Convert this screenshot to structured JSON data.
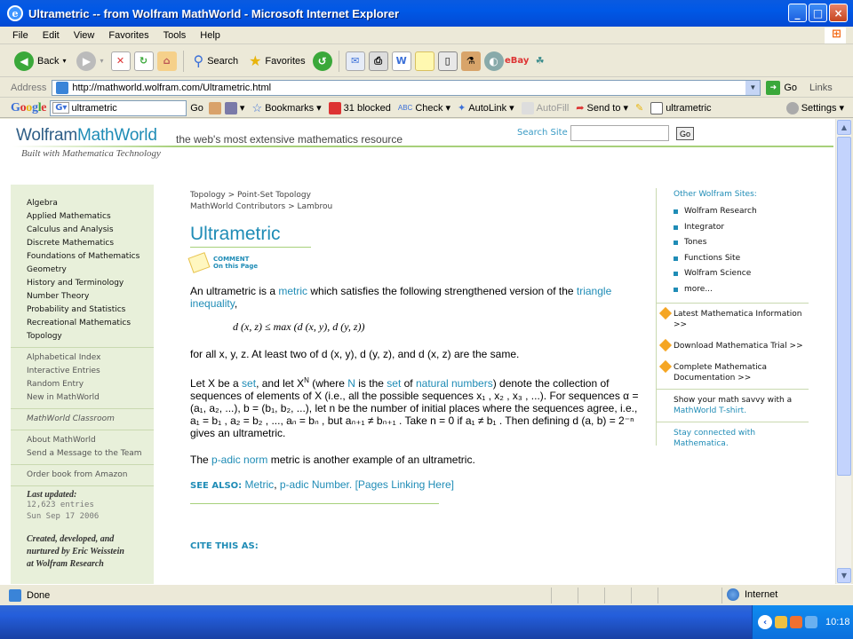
{
  "window": {
    "title": "Ultrametric -- from Wolfram MathWorld - Microsoft Internet Explorer"
  },
  "menu": [
    "File",
    "Edit",
    "View",
    "Favorites",
    "Tools",
    "Help"
  ],
  "toolbar": {
    "back": "Back",
    "search": "Search",
    "favorites": "Favorites"
  },
  "address": {
    "label": "Address",
    "url": "http://mathworld.wolfram.com/Ultrametric.html",
    "go": "Go",
    "links": "Links"
  },
  "google": {
    "logo": "Google",
    "query": "ultrametric",
    "go": "Go",
    "bookmarks": "Bookmarks",
    "blocked": "31 blocked",
    "check": "Check",
    "autolink": "AutoLink",
    "autofill": "AutoFill",
    "sendto": "Send to",
    "highlight": "ultrametric",
    "settings": "Settings"
  },
  "site": {
    "logo_a": "Wolfram",
    "logo_b": "MathWorld",
    "tagline": "the web's most extensive mathematics resource",
    "built": "Built with Mathematica Technology",
    "search_label": "Search Site",
    "search_go": "Go"
  },
  "leftnav": {
    "subjects": [
      "Algebra",
      "Applied Mathematics",
      "Calculus and Analysis",
      "Discrete Mathematics",
      "Foundations of Mathematics",
      "Geometry",
      "History and Terminology",
      "Number Theory",
      "Probability and Statistics",
      "Recreational Mathematics",
      "Topology"
    ],
    "indexes": [
      "Alphabetical Index",
      "Interactive Entries",
      "Random Entry",
      "New in MathWorld"
    ],
    "classroom": "MathWorld Classroom",
    "about": [
      "About MathWorld",
      "Send a Message to the Team"
    ],
    "order": "Order book from Amazon",
    "last_updated": "Last updated:",
    "entries": "12,623 entries",
    "date": "Sun Sep 17 2006",
    "credit": [
      "Created, developed, and",
      "nurtured by Eric Weisstein",
      "at Wolfram Research"
    ]
  },
  "main": {
    "crumb1": "Topology > Point-Set Topology",
    "crumb2": "MathWorld Contributors > Lambrou",
    "title": "Ultrametric",
    "comment1": "COMMENT",
    "comment2": "On this Page",
    "p1_a": "An ultrametric is a ",
    "p1_link1": "metric",
    "p1_b": " which satisfies the following strengthened version of the ",
    "p1_link2": "triangle inequality",
    "p1_c": ",",
    "equation": "d (x, z) ≤ max (d (x, y), d (y, z))",
    "p2": "for all x, y, z. At least two of d (x, y), d (y, z), and d (x, z) are the same.",
    "p3_a": "Let X be a ",
    "p3_set": "set",
    "p3_b": ", and let X",
    "p3_sup": "N",
    "p3_c": " (where ",
    "p3_n": "N",
    "p3_d": " is the ",
    "p3_set2": "set",
    "p3_e": " of ",
    "p3_nat": "natural numbers",
    "p3_f": ") denote the collection of sequences of elements of X (i.e., all the possible sequences x₁ , x₂ , x₃ , ...). For sequences α = (a₁, a₂, ...), b = (b₁, b₂, ...), let n be the number of initial places where the sequences agree, i.e., a₁ = b₁ , a₂ = b₂ , ..., aₙ = bₙ , but aₙ₊₁ ≠ bₙ₊₁ . Take n = 0 if a₁ ≠ b₁ . Then defining d (a, b) = 2⁻ⁿ gives an ultrametric.",
    "p4_a": "The ",
    "p4_link": "p-adic norm",
    "p4_b": " metric is another example of an ultrametric.",
    "see_label": "SEE ALSO:",
    "see_1": "Metric",
    "see_sep": ", ",
    "see_2": "p-adic Number",
    "see_3": ". [Pages Linking Here]",
    "cite": "CITE THIS AS:"
  },
  "right": {
    "header": "Other Wolfram Sites:",
    "sites": [
      "Wolfram Research",
      "Integrator",
      "Tones",
      "Functions Site",
      "Wolfram Science",
      "more..."
    ],
    "promo1": "Latest Mathematica Information >>",
    "promo2": "Download Mathematica Trial >>",
    "promo3": "Complete Mathematica Documentation >>",
    "promo4_a": "Show your math savvy with a ",
    "promo4_b": "MathWorld T-shirt.",
    "promo5": "Stay connected with Mathematica."
  },
  "status": {
    "text": "Done",
    "zone": "Internet"
  },
  "taskbar": {
    "clock": "10:18"
  }
}
